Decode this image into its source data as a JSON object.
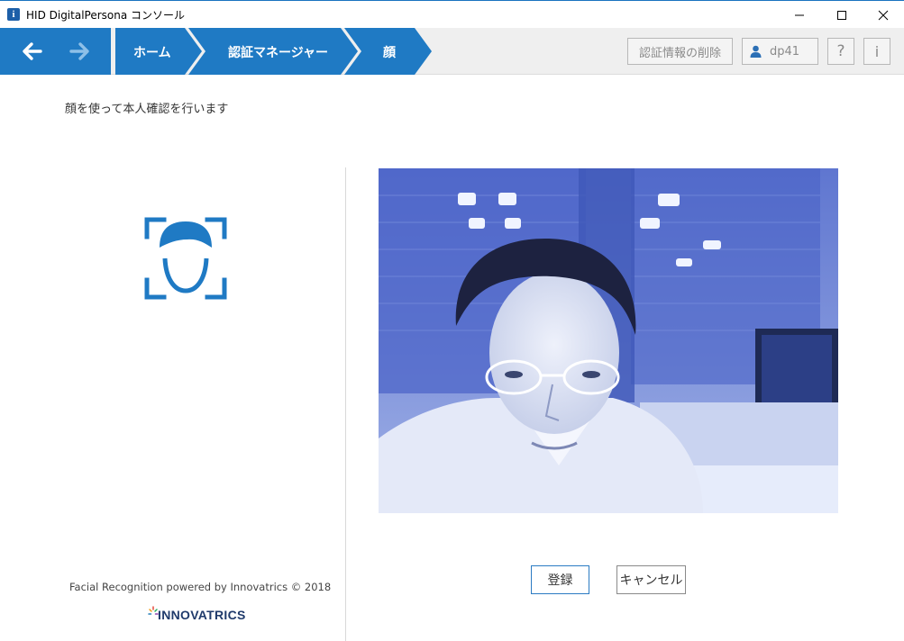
{
  "window": {
    "title": "HID DigitalPersona コンソール",
    "app_icon_glyph": "i"
  },
  "nav": {
    "breadcrumbs": [
      "ホーム",
      "認証マネージャー",
      "顔"
    ],
    "delete_credentials_label": "認証情報の削除",
    "user_name": "dp41",
    "help_label": "?",
    "info_label": "i"
  },
  "main": {
    "instruction": "顔を使って本人確認を行います",
    "register_label": "登録",
    "cancel_label": "キャンセル",
    "credit": "Facial Recognition powered by Innovatrics © 2018",
    "logo_text": "INNOVATRICS"
  },
  "colors": {
    "brand_blue": "#1f7ac4",
    "breadcrumb_blue": "#1f7ac4"
  },
  "icons": [
    "back-arrow-icon",
    "forward-arrow-icon",
    "user-icon",
    "face-scan-icon",
    "minimize-icon",
    "maximize-icon",
    "close-icon"
  ]
}
